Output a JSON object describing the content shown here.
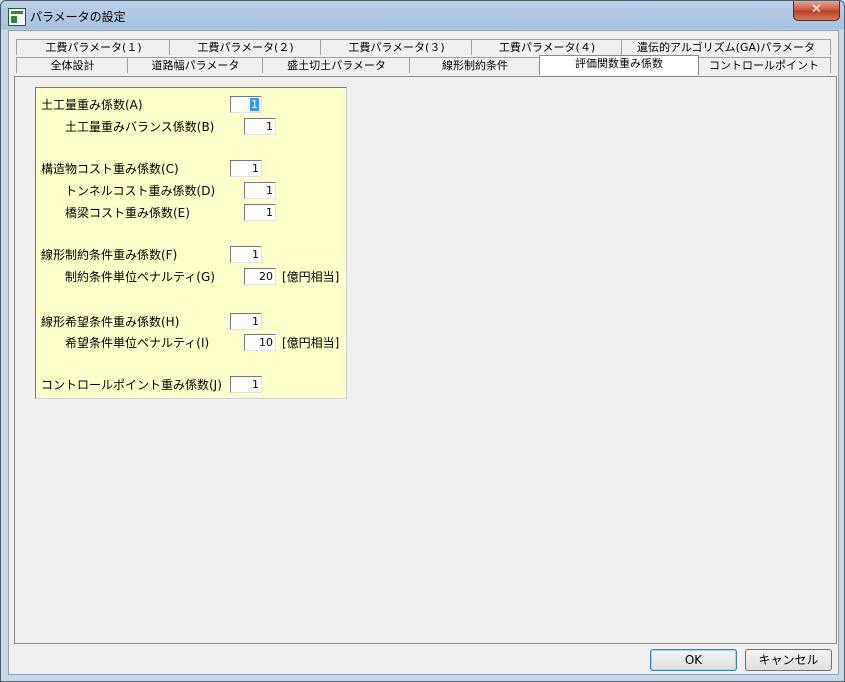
{
  "window": {
    "title": "パラメータの設定",
    "close_label": "✕"
  },
  "tabs_row1": [
    "工費パラメータ(１)",
    "工費パラメータ(２)",
    "工費パラメータ(３)",
    "工費パラメータ(４)",
    "遺伝的アルゴリズム(GA)パラメータ"
  ],
  "tabs_row2": [
    "全体設計",
    "道路幅パラメータ",
    "盛土切土パラメータ",
    "線形制約条件",
    "評価関数重み係数",
    "コントロールポイント"
  ],
  "active_tab": "評価関数重み係数",
  "form": {
    "earthwork_weight": {
      "label": "土工量重み係数(A)",
      "value": "1"
    },
    "earthwork_balance_weight": {
      "label": "土工量重みバランス係数(B)",
      "value": "1"
    },
    "structure_cost_weight": {
      "label": "構造物コスト重み係数(C)",
      "value": "1"
    },
    "tunnel_cost_weight": {
      "label": "トンネルコスト重み係数(D)",
      "value": "1"
    },
    "bridge_cost_weight": {
      "label": "橋梁コスト重み係数(E)",
      "value": "1"
    },
    "alignment_constraint_weight": {
      "label": "線形制約条件重み係数(F)",
      "value": "1"
    },
    "constraint_unit_penalty": {
      "label": "制約条件単位ペナルティ(G)",
      "value": "20",
      "unit": "[億円相当]"
    },
    "alignment_preference_weight": {
      "label": "線形希望条件重み係数(H)",
      "value": "1"
    },
    "preference_unit_penalty": {
      "label": "希望条件単位ペナルティ(I)",
      "value": "10",
      "unit": "[億円相当]"
    },
    "control_point_weight": {
      "label": "コントロールポイント重み係数(J)",
      "value": "1"
    }
  },
  "buttons": {
    "ok": "OK",
    "cancel": "キャンセル"
  }
}
